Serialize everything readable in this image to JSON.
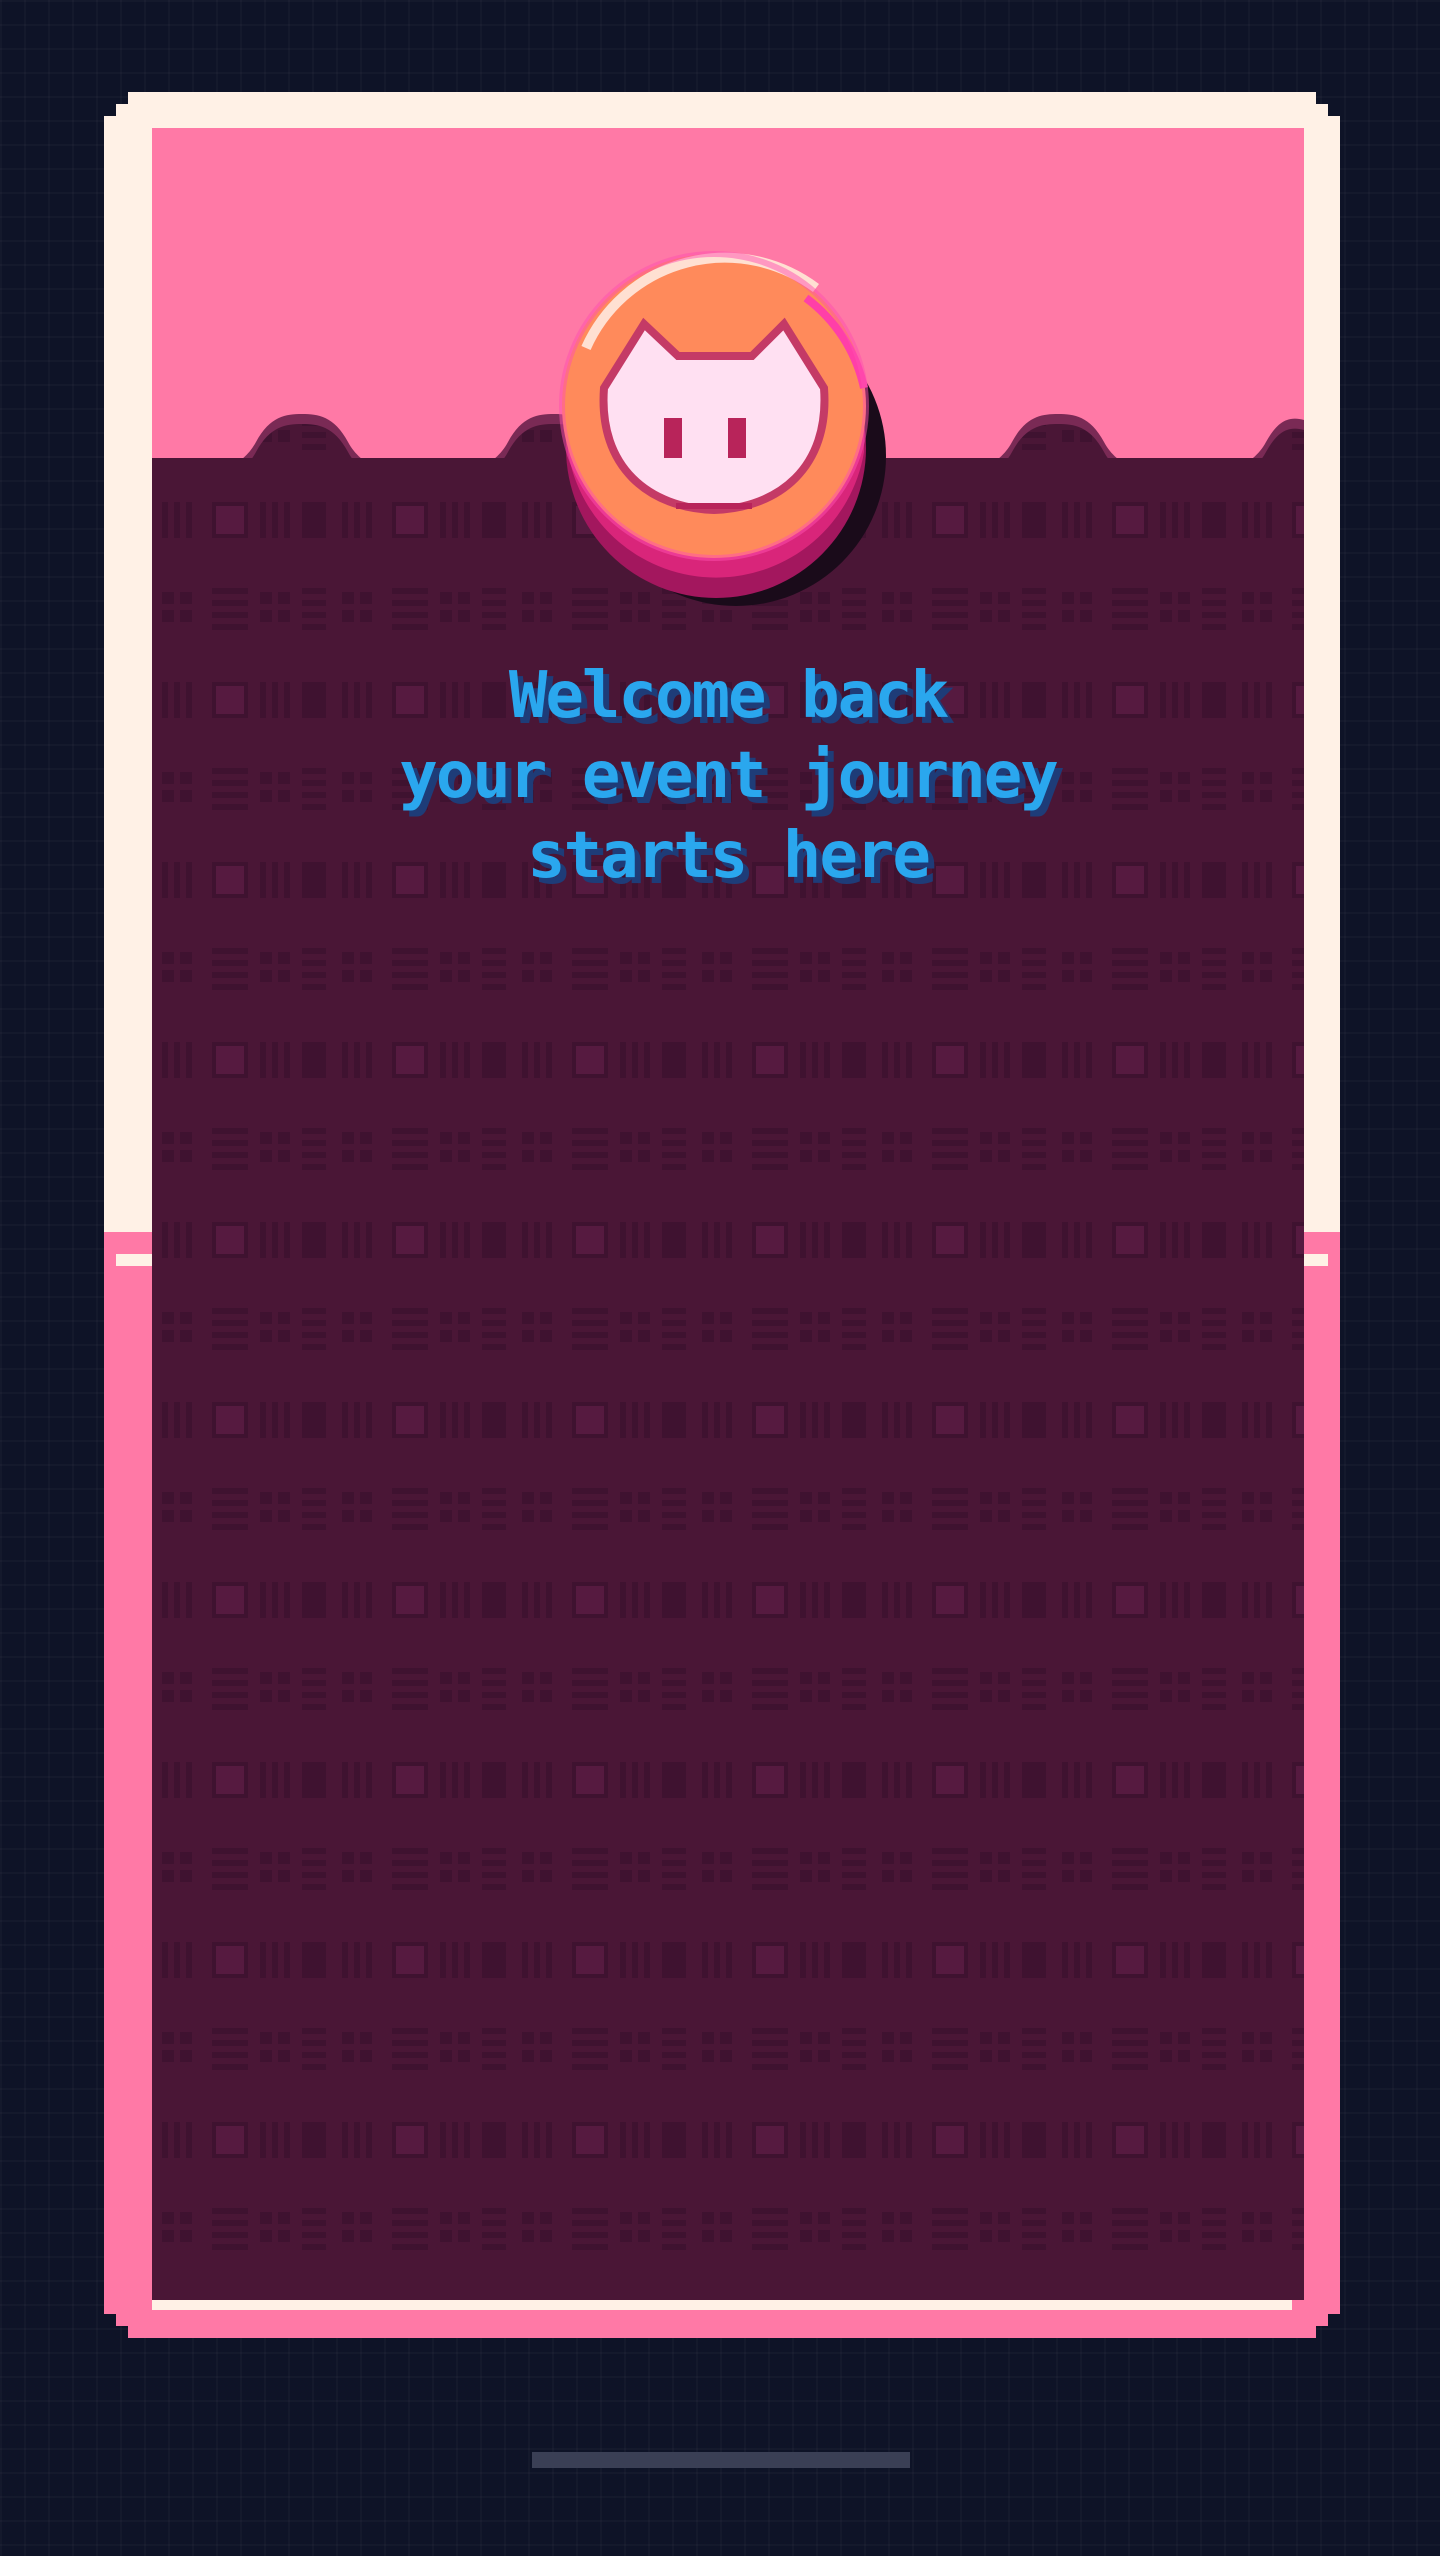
{
  "headline": {
    "line1": "Welcome back",
    "line2": "your event journey",
    "line3": "starts here"
  },
  "colors": {
    "background": "#0e1327",
    "card_frame": "#fff1e6",
    "accent_pink": "#ff79a6",
    "panel_dark": "#4a1636",
    "headline_blue": "#2aa7ee",
    "avatar_orange": "#ff8a5b"
  },
  "icons": {
    "avatar": "cat-face-coin-icon"
  }
}
